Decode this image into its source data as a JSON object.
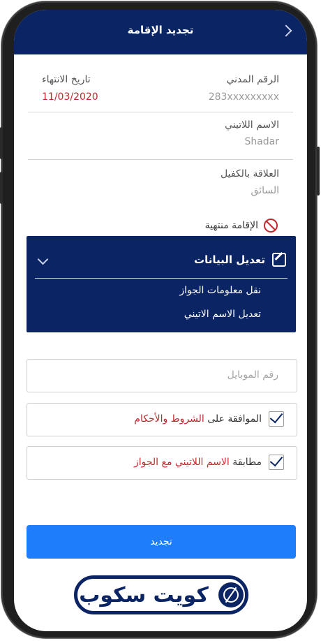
{
  "header": {
    "title": "تجديد الإقامة"
  },
  "civil_id": {
    "label": "الرقم المدني",
    "value": "283xxxxxxxxx"
  },
  "expiry": {
    "label": "تاريخ الانتهاء",
    "value": "11/03/2020"
  },
  "latin_name": {
    "label": "الاسم اللاتيني",
    "value": "Shadar"
  },
  "sponsor_relation": {
    "label": "العلاقة بالكفيل",
    "value": "السائق"
  },
  "status": {
    "text": "الإقامة منتهية"
  },
  "edit_panel": {
    "title": "تعديل البيانات",
    "items": [
      "نقل معلومات الجواز",
      "تعديل الاسم الاتيني"
    ]
  },
  "mobile": {
    "placeholder": "رقم الموبايل",
    "value": ""
  },
  "terms": {
    "prefix": "الموافقة على ",
    "link": "الشروط والأحكام",
    "checked": true
  },
  "name_match": {
    "prefix": "مطابقة ",
    "highlight": "الاسم اللاتيني مع الجواز",
    "checked": true
  },
  "renew_button": {
    "label": "تجديد"
  },
  "logo": {
    "text": "كويت سكوب"
  },
  "colors": {
    "primary": "#0b2463",
    "accent": "#1e7dfb",
    "danger": "#c1272d"
  }
}
